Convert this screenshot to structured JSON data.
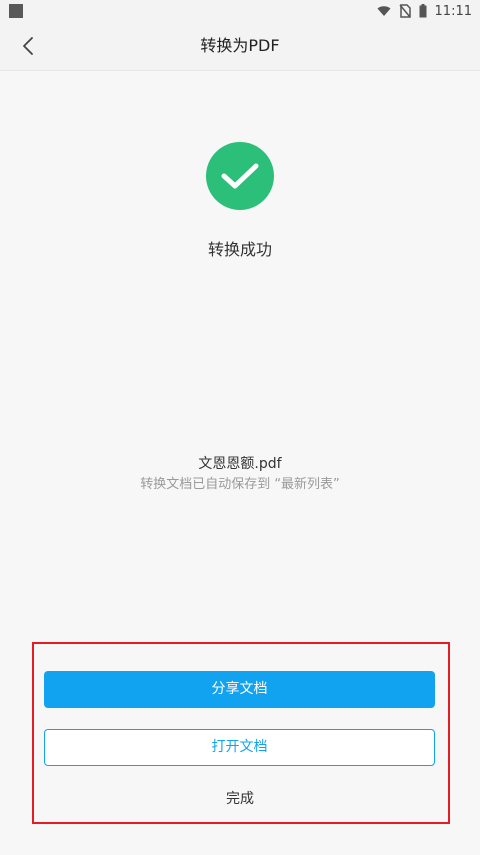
{
  "status_bar": {
    "time": "11:11",
    "icons": [
      "wifi-icon",
      "no-sim-icon",
      "battery-icon"
    ]
  },
  "header": {
    "title": "转换为PDF",
    "back_icon": "chevron-left-icon"
  },
  "result": {
    "icon": "check-circle-icon",
    "success_text": "转换成功",
    "file_name": "文恩恩额.pdf",
    "save_hint": "转换文档已自动保存到 “最新列表”"
  },
  "actions": {
    "share_label": "分享文档",
    "open_label": "打开文档",
    "done_label": "完成"
  },
  "colors": {
    "accent": "#12a3f0",
    "success": "#2bbf7a",
    "highlight_box": "#e51c23"
  }
}
